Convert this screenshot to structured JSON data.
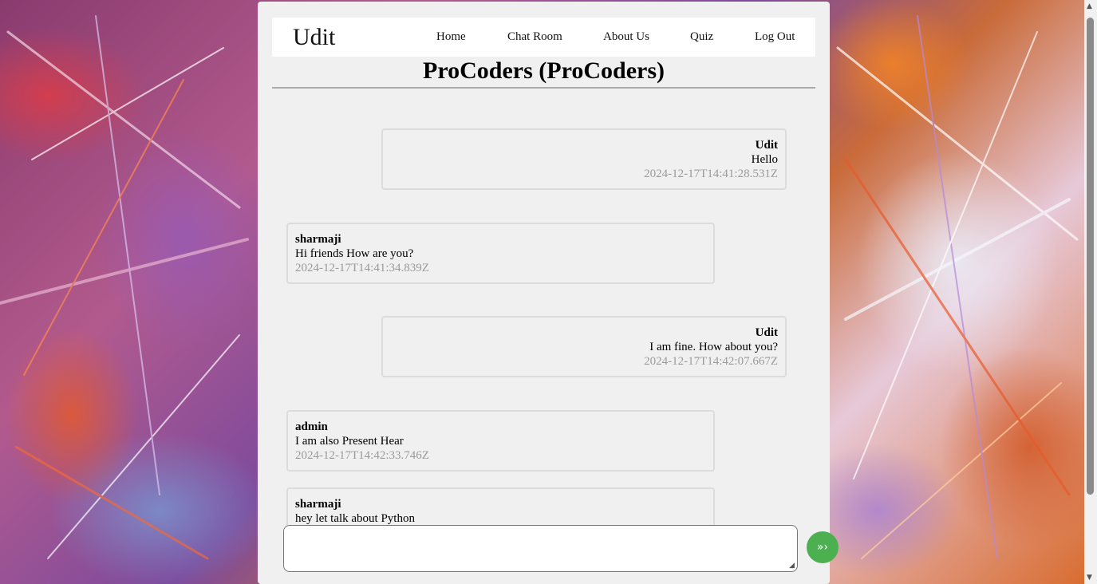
{
  "nav": {
    "brand": "Udit",
    "links": [
      "Home",
      "Chat Room",
      "About Us",
      "Quiz",
      "Log Out"
    ]
  },
  "room": {
    "title": "ProCoders (ProCoders)"
  },
  "messages": [
    {
      "sender": "Udit",
      "text": "Hello",
      "time": "2024-12-17T14:41:28.531Z",
      "mine": true
    },
    {
      "sender": "sharmaji",
      "text": "Hi friends How are you?",
      "time": "2024-12-17T14:41:34.839Z",
      "mine": false
    },
    {
      "sender": "Udit",
      "text": "I am fine. How about you?",
      "time": "2024-12-17T14:42:07.667Z",
      "mine": true
    },
    {
      "sender": "admin",
      "text": "I am also Present Hear",
      "time": "2024-12-17T14:42:33.746Z",
      "mine": false
    },
    {
      "sender": "sharmaji",
      "text": "hey let talk about Python",
      "time": "",
      "mine": false
    }
  ],
  "composer": {
    "value": "",
    "send_icon": "triple-chevron-right-icon",
    "send_glyph": "»›"
  },
  "colors": {
    "send_button": "#4caf50",
    "panel": "#f0f0f0"
  }
}
